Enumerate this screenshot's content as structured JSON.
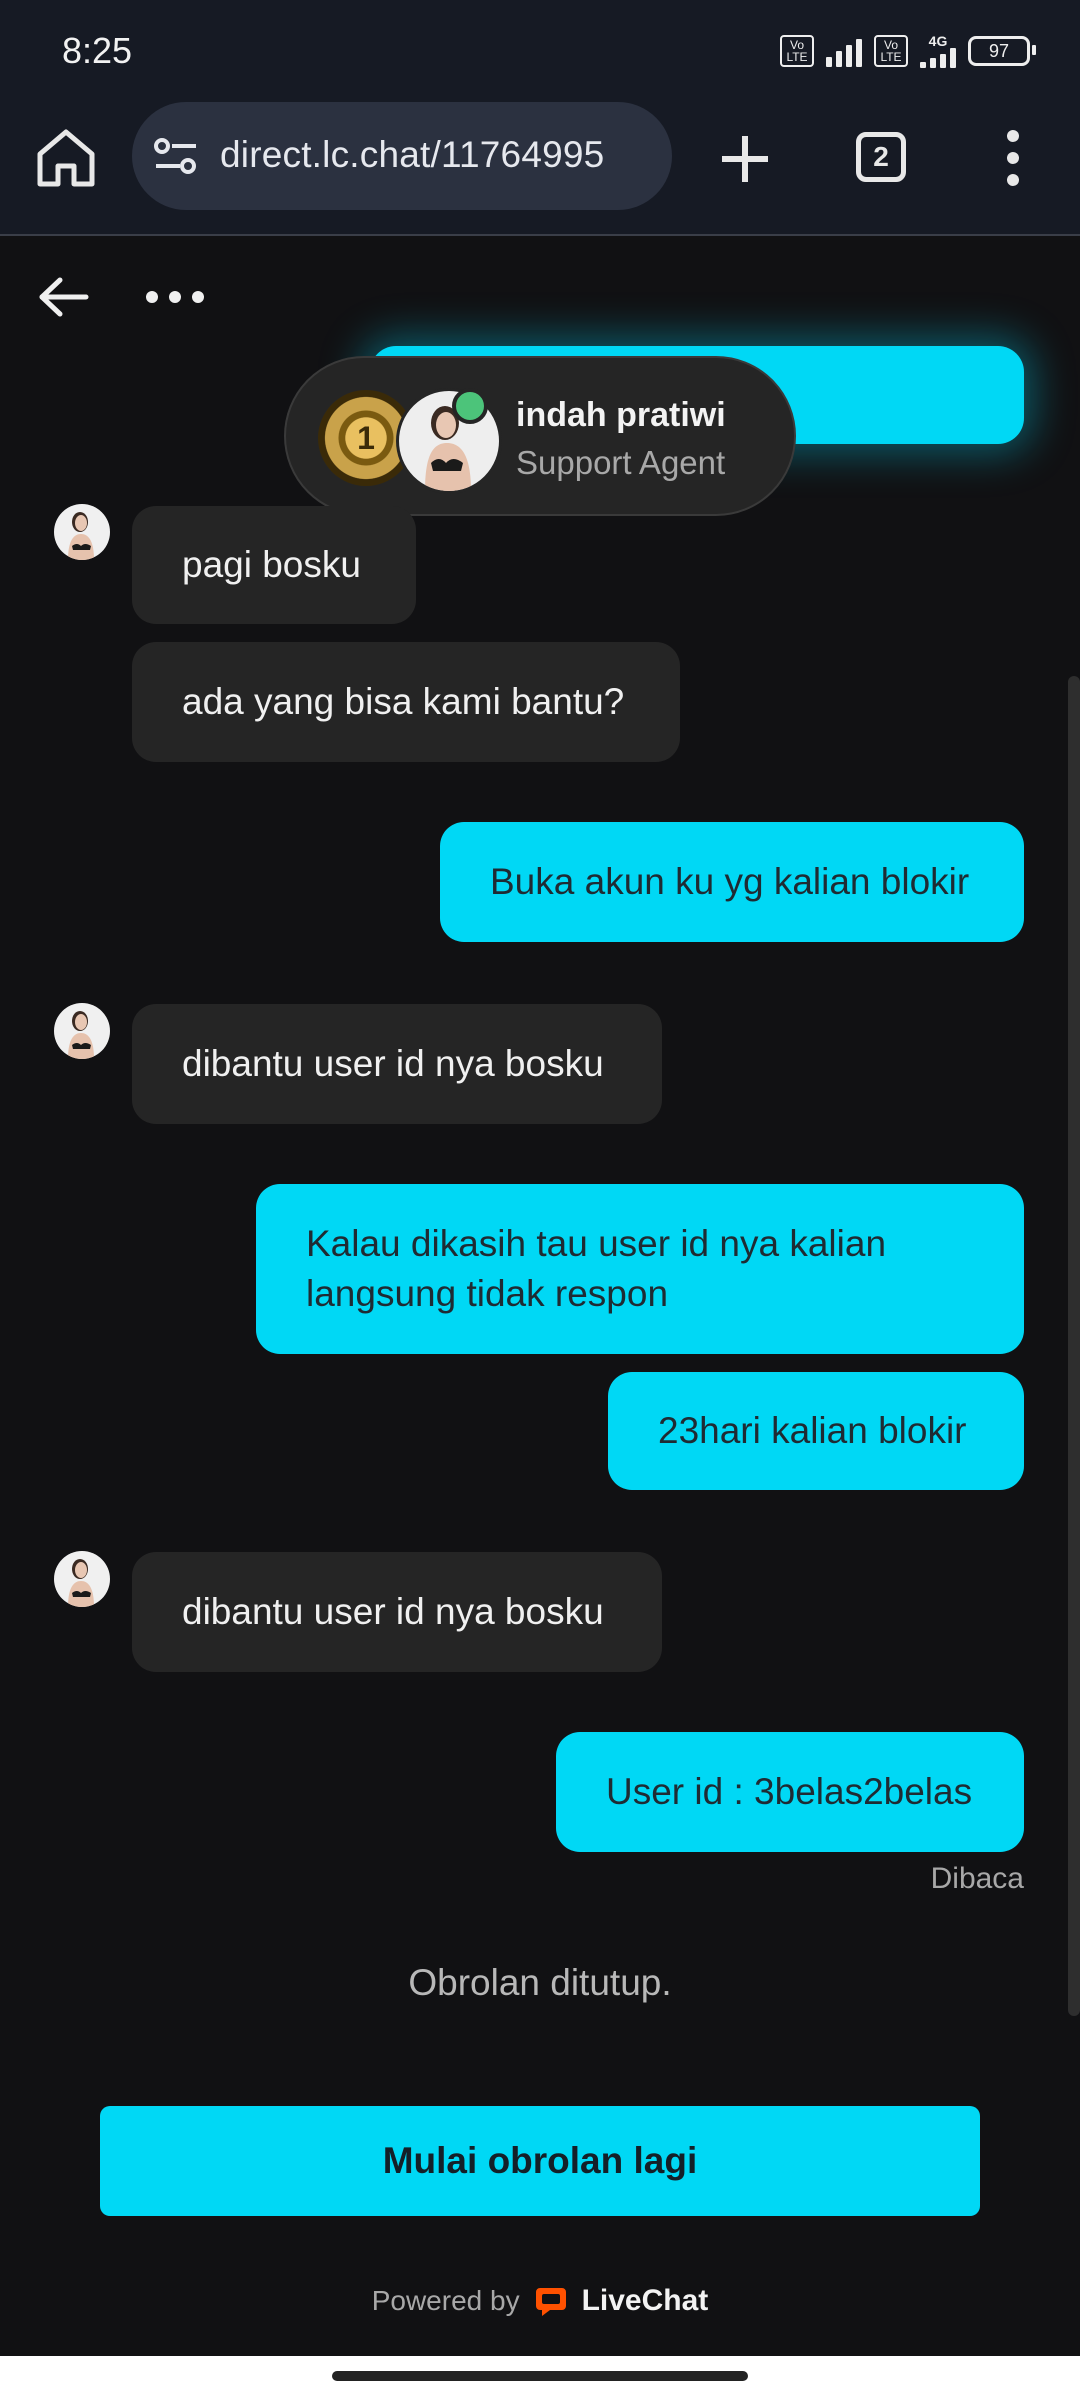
{
  "status_bar": {
    "time": "8:25",
    "battery": "97",
    "network": "4G",
    "volte_label_1": "Vo LTE",
    "volte_label_2": "Vo LTE"
  },
  "browser": {
    "url": "direct.lc.chat/11764995",
    "tab_count": "2"
  },
  "agent": {
    "name": "indah pratiwi",
    "role": "Support Agent",
    "badge": "1",
    "status_color": "#4cc47a"
  },
  "messages": [
    {
      "from": "agent",
      "text": "pagi bosku"
    },
    {
      "from": "agent",
      "text": "ada yang bisa kami bantu?"
    },
    {
      "from": "user",
      "text": "Buka akun ku yg kalian blokir"
    },
    {
      "from": "agent",
      "text": "dibantu user id nya bosku"
    },
    {
      "from": "user",
      "text": "Kalau dikasih tau user id nya kalian langsung tidak respon"
    },
    {
      "from": "user",
      "text": "23hari kalian blokir"
    },
    {
      "from": "agent",
      "text": "dibantu user id nya bosku"
    },
    {
      "from": "user",
      "text": "User id : 3belas2belas"
    }
  ],
  "read_status": "Dibaca",
  "chat_closed": "Obrolan ditutup.",
  "restart_button": "Mulai obrolan lagi",
  "footer": {
    "powered_by": "Powered by",
    "brand": "LiveChat"
  },
  "colors": {
    "accent": "#00d8f5",
    "background": "#111113",
    "agent_bubble": "#252525",
    "brand_orange": "#ff5100"
  }
}
